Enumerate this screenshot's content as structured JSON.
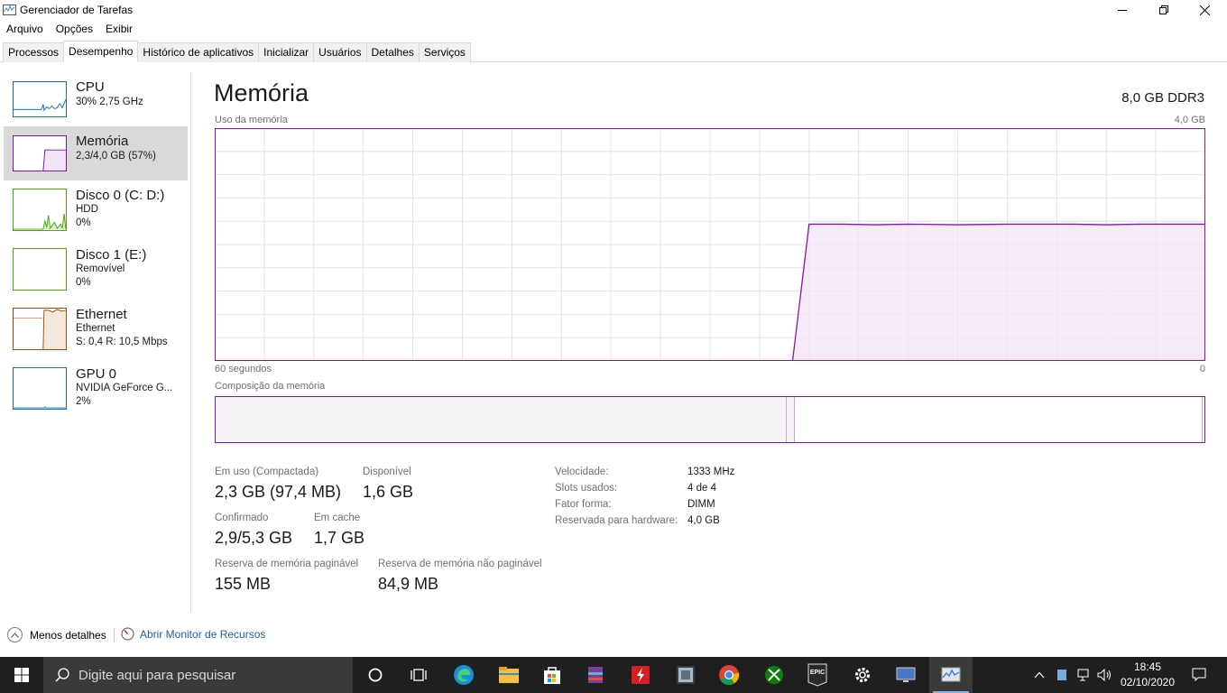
{
  "window": {
    "title": "Gerenciador de Tarefas"
  },
  "menu": [
    "Arquivo",
    "Opções",
    "Exibir"
  ],
  "tabs": [
    "Processos",
    "Desempenho",
    "Histórico de aplicativos",
    "Inicializar",
    "Usuários",
    "Detalhes",
    "Serviços"
  ],
  "active_tab": "Desempenho",
  "sidebar": [
    {
      "title": "CPU",
      "line1": "30%  2,75 GHz",
      "line2": "",
      "color": "#1174b8"
    },
    {
      "title": "Memória",
      "line1": "2,3/4,0 GB (57%)",
      "line2": "",
      "color": "#8b12ae",
      "selected": true
    },
    {
      "title": "Disco 0 (C: D:)",
      "line1": "HDD",
      "line2": "0%",
      "color": "#4da60c"
    },
    {
      "title": "Disco 1 (E:)",
      "line1": "Removível",
      "line2": "0%",
      "color": "#4da60c"
    },
    {
      "title": "Ethernet",
      "line1": "Ethernet",
      "line2": "S: 0,4  R: 10,5 Mbps",
      "color": "#a74f01"
    },
    {
      "title": "GPU 0",
      "line1": "NVIDIA GeForce G...",
      "line2": "2%",
      "color": "#1174b8"
    }
  ],
  "main": {
    "title": "Memória",
    "mem_type": "8,0 GB DDR3",
    "usage_label": "Uso da memória",
    "usage_max": "4,0 GB",
    "time_left": "60 segundos",
    "time_right": "0",
    "composition_label": "Composição da memória",
    "composition": {
      "in_use_fraction": 0.577,
      "modified_fraction": 0.008,
      "standby_fraction": 0.413
    }
  },
  "stats": {
    "in_use_label": "Em uso (Compactada)",
    "in_use_value": "2,3 GB (97,4 MB)",
    "available_label": "Disponível",
    "available_value": "1,6 GB",
    "committed_label": "Confirmado",
    "committed_value": "2,9/5,3 GB",
    "cached_label": "Em cache",
    "cached_value": "1,7 GB",
    "paged_label": "Reserva de memória paginável",
    "paged_value": "155 MB",
    "nonpaged_label": "Reserva de memória não paginável",
    "nonpaged_value": "84,9 MB"
  },
  "specs": [
    {
      "key": "Velocidade:",
      "value": "1333 MHz"
    },
    {
      "key": "Slots usados:",
      "value": "4 de 4"
    },
    {
      "key": "Fator forma:",
      "value": "DIMM"
    },
    {
      "key": "Reservada para hardware:",
      "value": "4,0 GB"
    }
  ],
  "footer": {
    "less_details": "Menos detalhes",
    "resource_monitor": "Abrir Monitor de Recursos"
  },
  "taskbar": {
    "search_placeholder": "Digite aqui para pesquisar",
    "time": "18:45",
    "date": "02/10/2020"
  },
  "chart_data": {
    "type": "area",
    "xlabel": "60 segundos",
    "ylabel": "Uso da memória",
    "xlim": [
      60,
      0
    ],
    "ylim": [
      0,
      4.0
    ],
    "grid": true,
    "x": [
      60,
      25,
      24,
      22,
      20,
      18,
      15,
      12,
      10,
      8,
      6,
      4,
      2,
      0
    ],
    "values": [
      0,
      0,
      2.35,
      2.35,
      2.34,
      2.35,
      2.34,
      2.35,
      2.35,
      2.35,
      2.34,
      2.35,
      2.35,
      2.35
    ]
  }
}
